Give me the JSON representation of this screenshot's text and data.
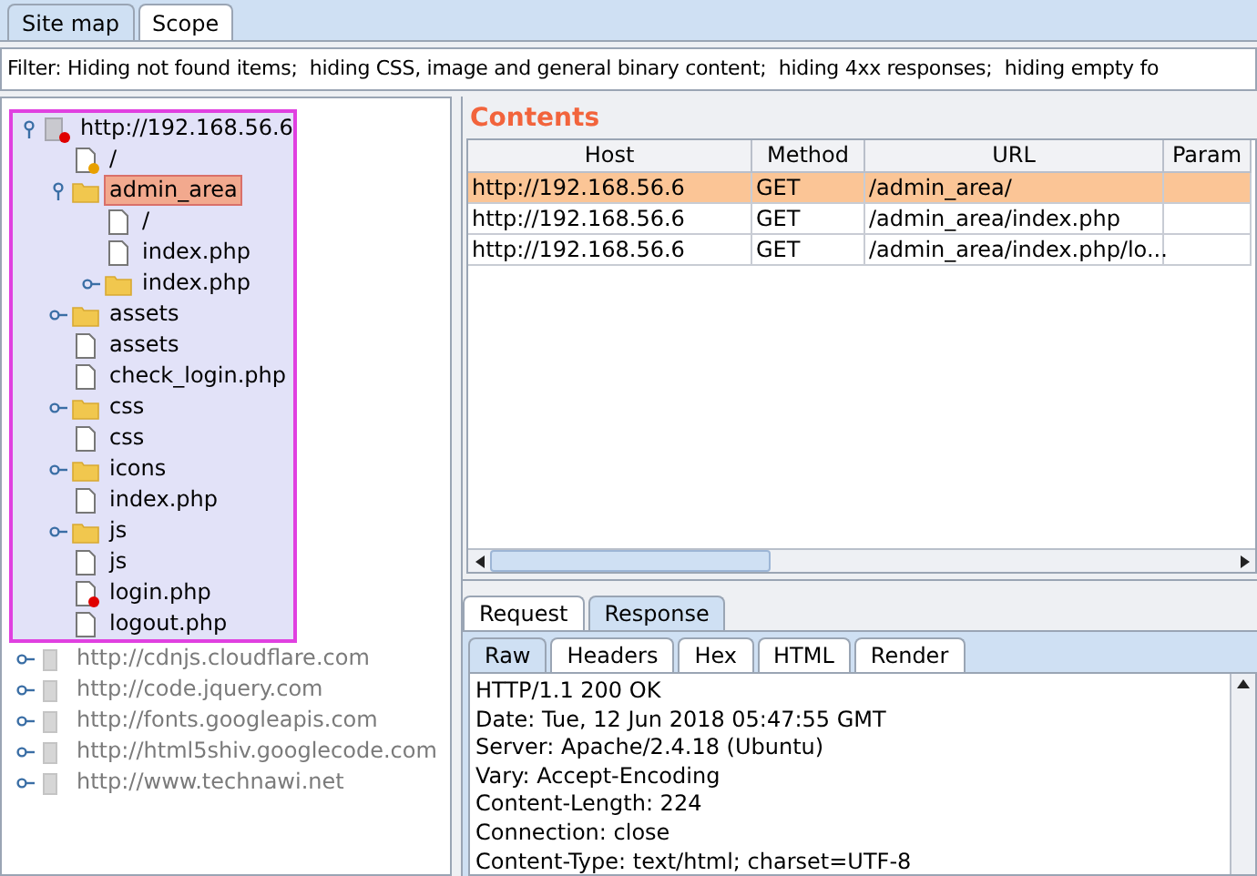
{
  "top_tabs": [
    {
      "label": "Site map",
      "selected": true
    },
    {
      "label": "Scope",
      "selected": false
    }
  ],
  "filter": "Filter: Hiding not found items;  hiding CSS, image and general binary content;  hiding 4xx responses;  hiding empty fo",
  "site_tree": [
    {
      "label": "http://192.168.56.6",
      "kind": "host",
      "expanded": true,
      "highlighted": true,
      "in_scope": true,
      "selected": false,
      "color": "#e00000",
      "children": [
        {
          "label": "/",
          "kind": "file",
          "selected": false,
          "in_scope": true,
          "color": "#e8a000"
        },
        {
          "label": "admin_area",
          "kind": "folder",
          "expanded": true,
          "selected": true,
          "in_scope": true,
          "children": [
            {
              "label": "/",
              "kind": "file",
              "selected": false,
              "in_scope": true
            },
            {
              "label": "index.php",
              "kind": "file",
              "selected": false,
              "in_scope": true
            },
            {
              "label": "index.php",
              "kind": "folder",
              "expanded": false,
              "selected": false,
              "in_scope": true
            }
          ]
        },
        {
          "label": "assets",
          "kind": "folder",
          "expanded": false,
          "selected": false,
          "in_scope": true
        },
        {
          "label": "assets",
          "kind": "file",
          "selected": false,
          "in_scope": true
        },
        {
          "label": "check_login.php",
          "kind": "file",
          "selected": false,
          "in_scope": true
        },
        {
          "label": "css",
          "kind": "folder",
          "expanded": false,
          "selected": false,
          "in_scope": true
        },
        {
          "label": "css",
          "kind": "file",
          "selected": false,
          "in_scope": true
        },
        {
          "label": "icons",
          "kind": "folder",
          "expanded": false,
          "selected": false,
          "in_scope": true
        },
        {
          "label": "index.php",
          "kind": "file",
          "selected": false,
          "in_scope": true
        },
        {
          "label": "js",
          "kind": "folder",
          "expanded": false,
          "selected": false,
          "in_scope": true
        },
        {
          "label": "js",
          "kind": "file",
          "selected": false,
          "in_scope": true
        },
        {
          "label": "login.php",
          "kind": "file",
          "selected": false,
          "in_scope": true,
          "color": "#e00000"
        },
        {
          "label": "logout.php",
          "kind": "file",
          "selected": false,
          "in_scope": true
        }
      ]
    },
    {
      "label": "http://cdnjs.cloudflare.com",
      "kind": "host",
      "expanded": false,
      "highlighted": false,
      "in_scope": false,
      "selected": false
    },
    {
      "label": "http://code.jquery.com",
      "kind": "host",
      "expanded": false,
      "highlighted": false,
      "in_scope": false,
      "selected": false
    },
    {
      "label": "http://fonts.googleapis.com",
      "kind": "host",
      "expanded": false,
      "highlighted": false,
      "in_scope": false,
      "selected": false
    },
    {
      "label": "http://html5shiv.googlecode.com",
      "kind": "host",
      "expanded": false,
      "highlighted": false,
      "in_scope": false,
      "selected": false
    },
    {
      "label": "http://www.technawi.net",
      "kind": "host",
      "expanded": false,
      "highlighted": false,
      "in_scope": false,
      "selected": false
    }
  ],
  "contents": {
    "title": "Contents",
    "columns": [
      "Host",
      "Method",
      "URL",
      "Param"
    ],
    "rows": [
      {
        "cells": [
          "http://192.168.56.6",
          "GET",
          "/admin_area/",
          ""
        ],
        "selected": true
      },
      {
        "cells": [
          "http://192.168.56.6",
          "GET",
          "/admin_area/index.php",
          ""
        ],
        "selected": false
      },
      {
        "cells": [
          "http://192.168.56.6",
          "GET",
          "/admin_area/index.php/lo...",
          ""
        ],
        "selected": false
      }
    ]
  },
  "message_tabs": [
    {
      "label": "Request",
      "selected": false
    },
    {
      "label": "Response",
      "selected": true
    }
  ],
  "view_tabs": [
    {
      "label": "Raw",
      "selected": true
    },
    {
      "label": "Headers",
      "selected": false
    },
    {
      "label": "Hex",
      "selected": false
    },
    {
      "label": "HTML",
      "selected": false
    },
    {
      "label": "Render",
      "selected": false
    }
  ],
  "response_lines": [
    "HTTP/1.1 200 OK",
    "Date: Tue, 12 Jun 2018 05:47:55 GMT",
    "Server: Apache/2.4.18 (Ubuntu)",
    "Vary: Accept-Encoding",
    "Content-Length: 224",
    "Connection: close",
    "Content-Type: text/html; charset=UTF-8"
  ]
}
